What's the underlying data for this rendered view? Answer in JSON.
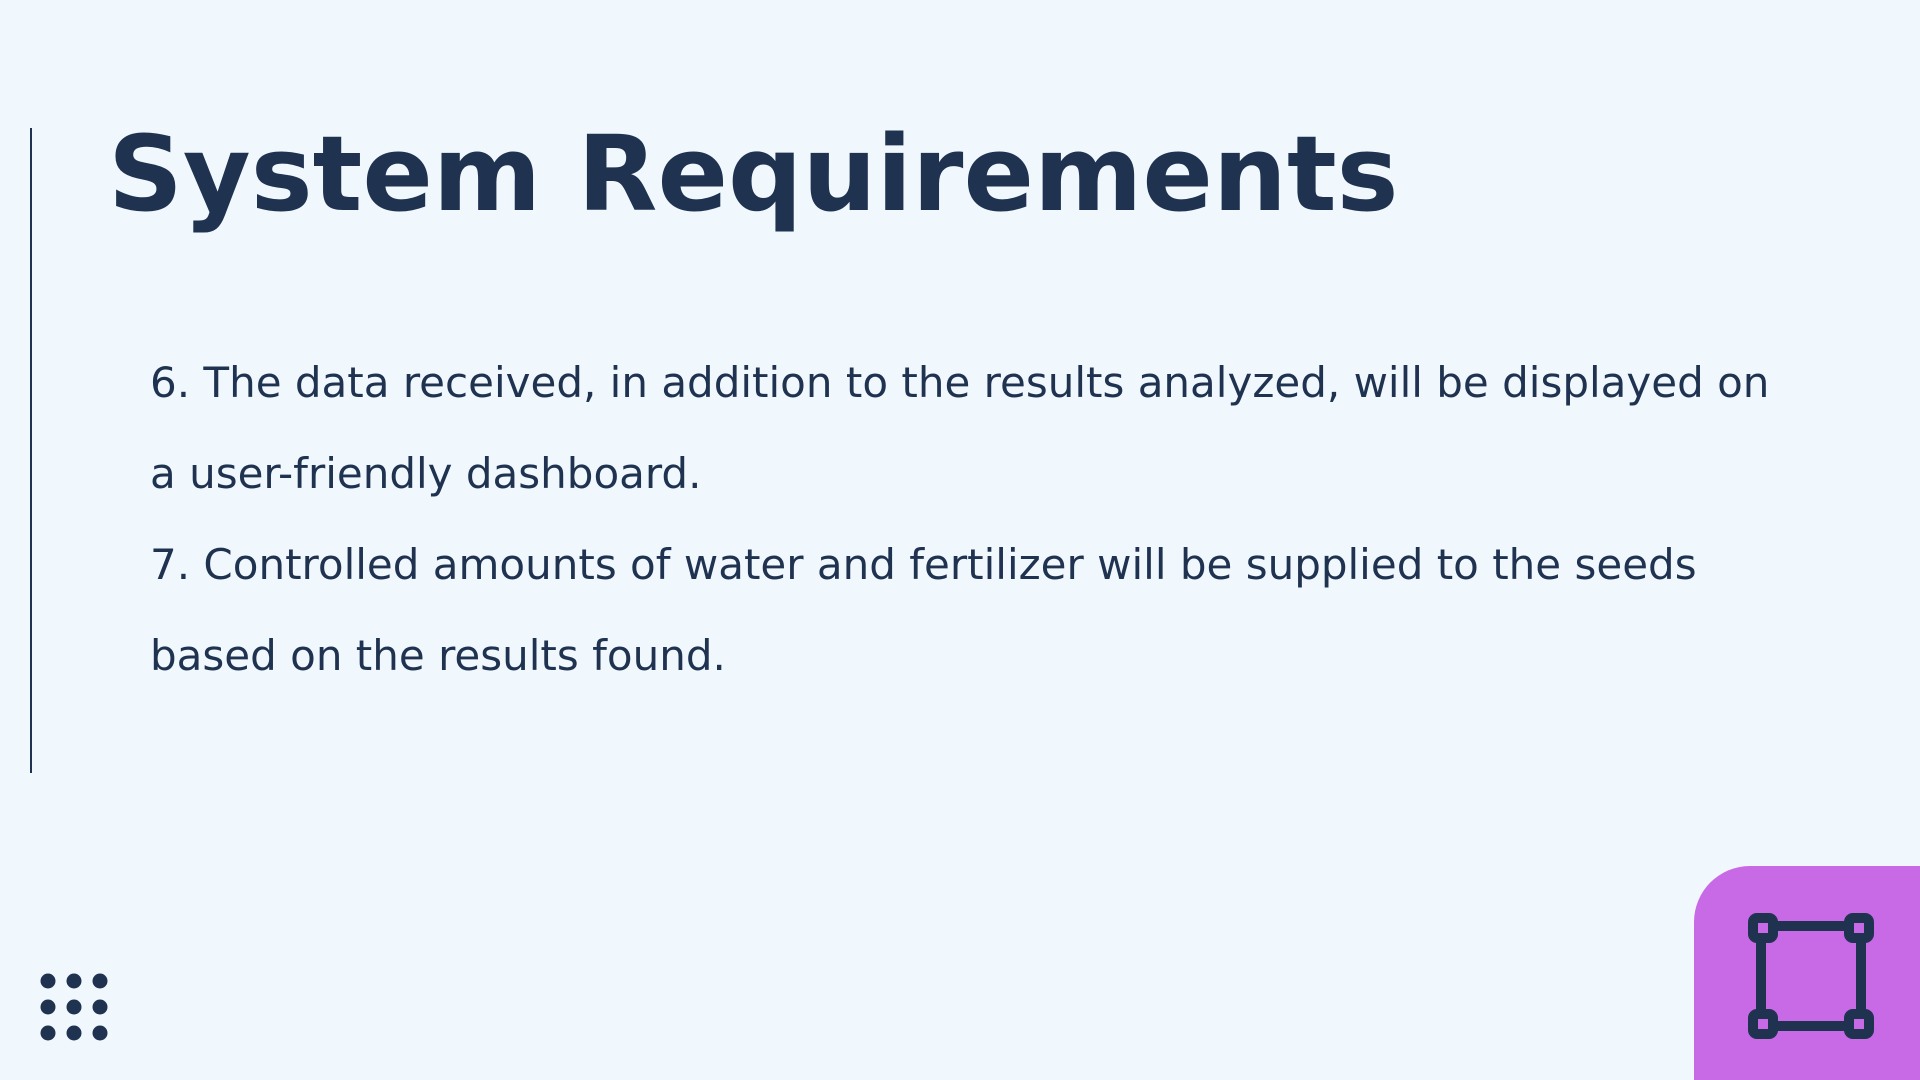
{
  "slide": {
    "title": "System Requirements",
    "paragraphs": [
      "6. The data received, in addition to the results analyzed, will be displayed on a user-friendly dashboard.",
      "7. Controlled amounts of water and fertilizer will be supplied to the seeds based on the results found."
    ]
  },
  "decorations": {
    "dots_icon": "dot-grid-icon",
    "corner_icon": "selection-frame-icon"
  },
  "colors": {
    "background": "#f0f8fe",
    "text": "#1f3250",
    "accent": "#c86ae6"
  }
}
